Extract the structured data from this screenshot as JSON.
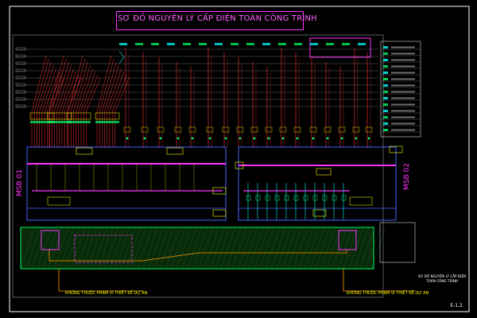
{
  "title": "SƠ ĐỒ NGUYÊN LÝ CẤP ĐIỆN TOÀN CÔNG TRÌNH",
  "msb_left": "MSB 01",
  "msb_right": "MSB 02",
  "note_left": "KHÔNG THUỘC PHẠM VI THIẾT KẾ DỰ ÁN",
  "note_right": "KHÔNG THUỘC PHẠM VI THIẾT KẾ DỰ ÁN",
  "stamp_line1": "SƠ ĐỒ NGUYÊN LÝ CẤP ĐIỆN",
  "stamp_line2": "TOÀN CÔNG TRÌNH",
  "sheet_number": "E-1.2",
  "colors": {
    "background": "#000000",
    "frame": "#ffffff",
    "title": "#ff66ff",
    "busbar": "#ff33ff",
    "feeder": "#ff3333",
    "busline": "#4466ff",
    "green": "#00ff66",
    "cyan": "#00ffff",
    "yellow": "#ffff00",
    "leader": "#ff9900"
  }
}
